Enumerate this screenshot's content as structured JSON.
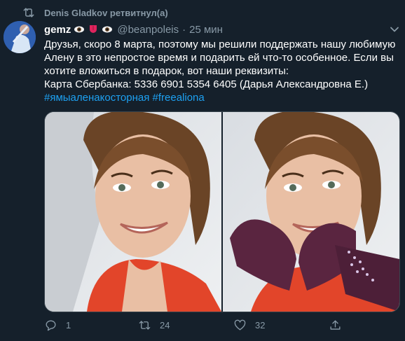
{
  "retweet_banner": {
    "text": "Denis Gladkov ретвитнул(а)"
  },
  "tweet": {
    "author_name": "gemz",
    "emojis": [
      "eye-emoji",
      "tongue-emoji",
      "eye-emoji"
    ],
    "handle": "@beanpoleis",
    "separator": "·",
    "time": "25 мин",
    "text_lines": [
      "Друзья, скоро 8 марта, поэтому мы решили поддержать нашу любимую",
      "Алену в это непростое время и подарить ей что-то особенное. Если вы",
      "хотите вложиться в подарок, вот наши реквизиты:",
      "Карта Сбербанка: 5336 6901 5354 6405 (Дарья Александровна Е.)"
    ],
    "hashtags": [
      "#ямыаленакосторная",
      "#freealiona"
    ]
  },
  "media": [
    {
      "icon": "photo-smiling-skater"
    },
    {
      "icon": "photo-skater-heart-hands"
    }
  ],
  "actions": {
    "reply_count": "1",
    "retweet_count": "24",
    "like_count": "32"
  },
  "colors": {
    "background": "#15202b",
    "secondary_text": "#8899a6",
    "link": "#1da1f2",
    "border": "#38444d"
  }
}
